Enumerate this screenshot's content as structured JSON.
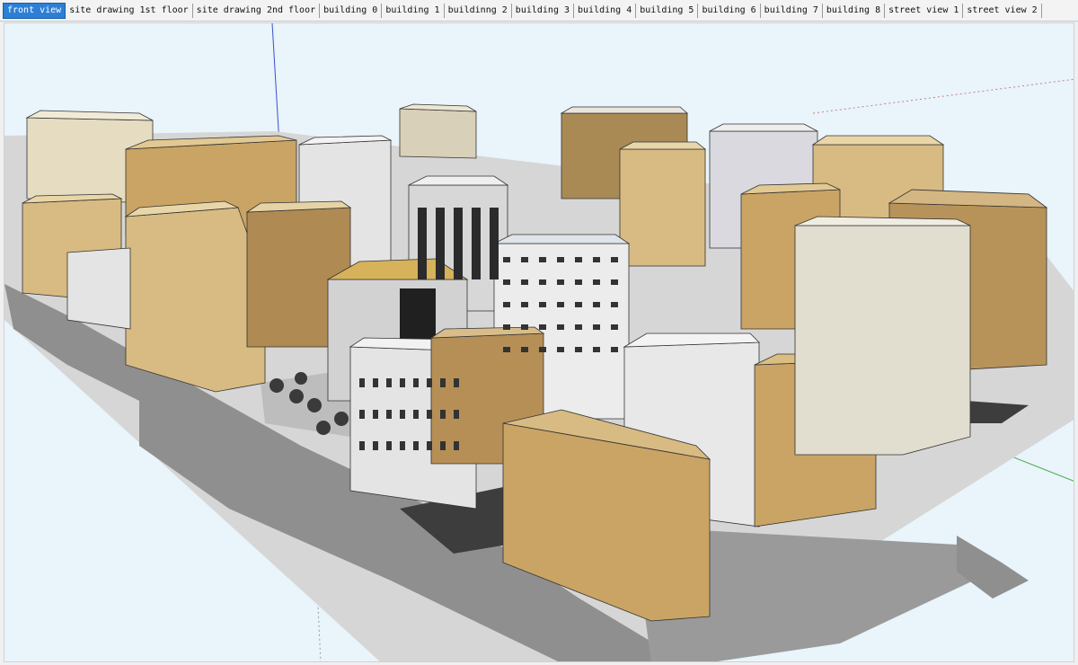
{
  "tabs": [
    {
      "label": "front view",
      "active": true
    },
    {
      "label": "site drawing 1st floor",
      "active": false
    },
    {
      "label": "site drawing 2nd floor",
      "active": false
    },
    {
      "label": "building 0",
      "active": false
    },
    {
      "label": "building 1",
      "active": false
    },
    {
      "label": "buildinng 2",
      "active": false
    },
    {
      "label": "building 3",
      "active": false
    },
    {
      "label": "building 4",
      "active": false
    },
    {
      "label": "building 5",
      "active": false
    },
    {
      "label": "building 6",
      "active": false
    },
    {
      "label": "building 7",
      "active": false
    },
    {
      "label": "building 8",
      "active": false
    },
    {
      "label": "street view 1",
      "active": false
    },
    {
      "label": "street view 2",
      "active": false
    }
  ],
  "colors": {
    "sky": "#e9f4fb",
    "ground": "#d6d6d6",
    "shadow": "#8f8f8f",
    "road": "#3d3d3d",
    "tan_light": "#d8bb82",
    "tan_mid": "#c9a465",
    "tan_dark": "#a98a55",
    "gray_light": "#e4e4e4",
    "gray_mid": "#cfcfcf",
    "beige": "#e6dcc1",
    "tab_active": "#2d7fd6"
  }
}
